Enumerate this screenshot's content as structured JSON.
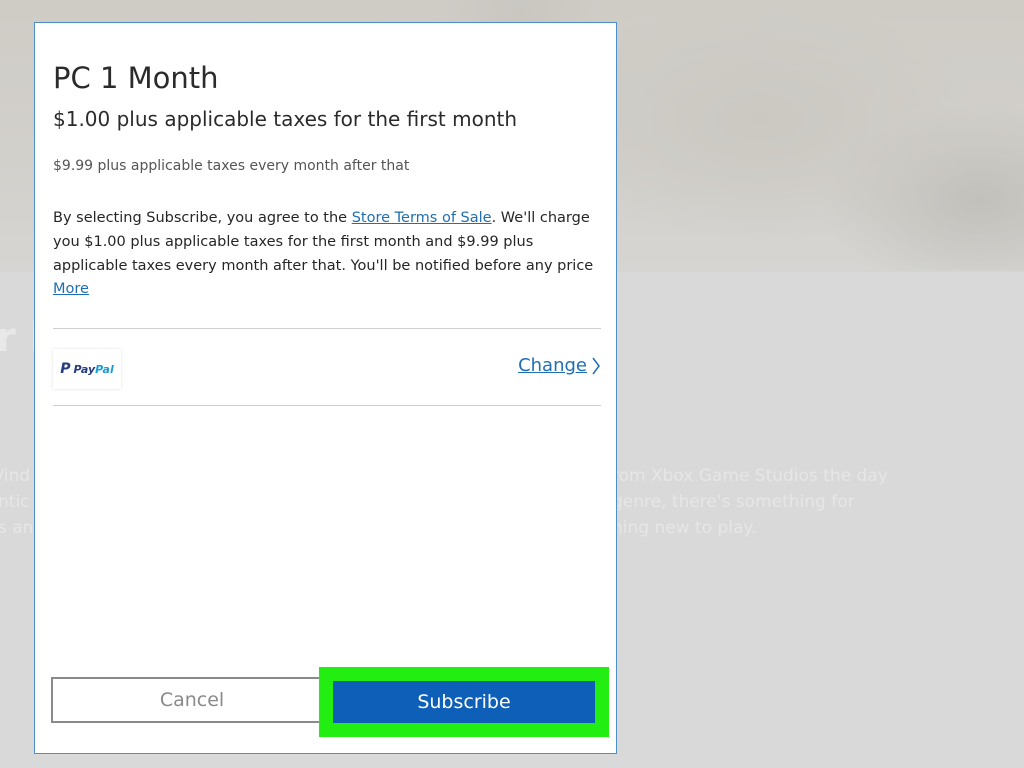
{
  "background": {
    "heading_fragment": "r l",
    "text_left_lines": [
      "/ind",
      "ntic",
      "s an"
    ],
    "text_right_lines": [
      "rom Xbox Game Studios the day",
      "genre, there's something for",
      "hing new to play."
    ]
  },
  "dialog": {
    "title": "PC 1 Month",
    "subtitle": "$1.00 plus applicable taxes for the first month",
    "recurring_note": "$9.99 plus applicable taxes every month after that",
    "terms": {
      "prefix": "By selecting Subscribe, you agree to the ",
      "link_label": "Store Terms of Sale",
      "suffix": ". We'll charge you $1.00 plus applicable taxes for the first month and $9.99 plus applicable taxes every month after that. You'll be notified before any price"
    },
    "more_label": "More",
    "payment": {
      "method_icon": "paypal-logo",
      "logo_p": "P",
      "logo_pay": "Pay",
      "logo_pal": "Pal",
      "change_label": "Change"
    },
    "cancel_label": "Cancel",
    "subscribe_label": "Subscribe"
  },
  "colors": {
    "accent": "#0d5fb8",
    "link": "#1f6fb2",
    "highlight": "#22ee11",
    "dialog_border": "#4d90c9",
    "overlay": "#d9d9d9"
  }
}
